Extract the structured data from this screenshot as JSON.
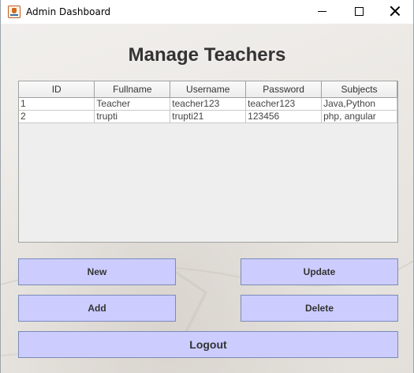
{
  "window": {
    "title": "Admin Dashboard",
    "icon": "java-cup-icon"
  },
  "page": {
    "heading": "Manage Teachers"
  },
  "table": {
    "columns": [
      "ID",
      "Fullname",
      "Username",
      "Password",
      "Subjects"
    ],
    "rows": [
      [
        "1",
        "Teacher",
        "teacher123",
        "teacher123",
        "Java,Python"
      ],
      [
        "2",
        "trupti",
        "trupti21",
        "123456",
        "php, angular"
      ]
    ]
  },
  "buttons": {
    "new": "New",
    "update": "Update",
    "add": "Add",
    "delete": "Delete",
    "logout": "Logout"
  },
  "colors": {
    "button_fill": "#ccccff",
    "heading": "#333333"
  }
}
